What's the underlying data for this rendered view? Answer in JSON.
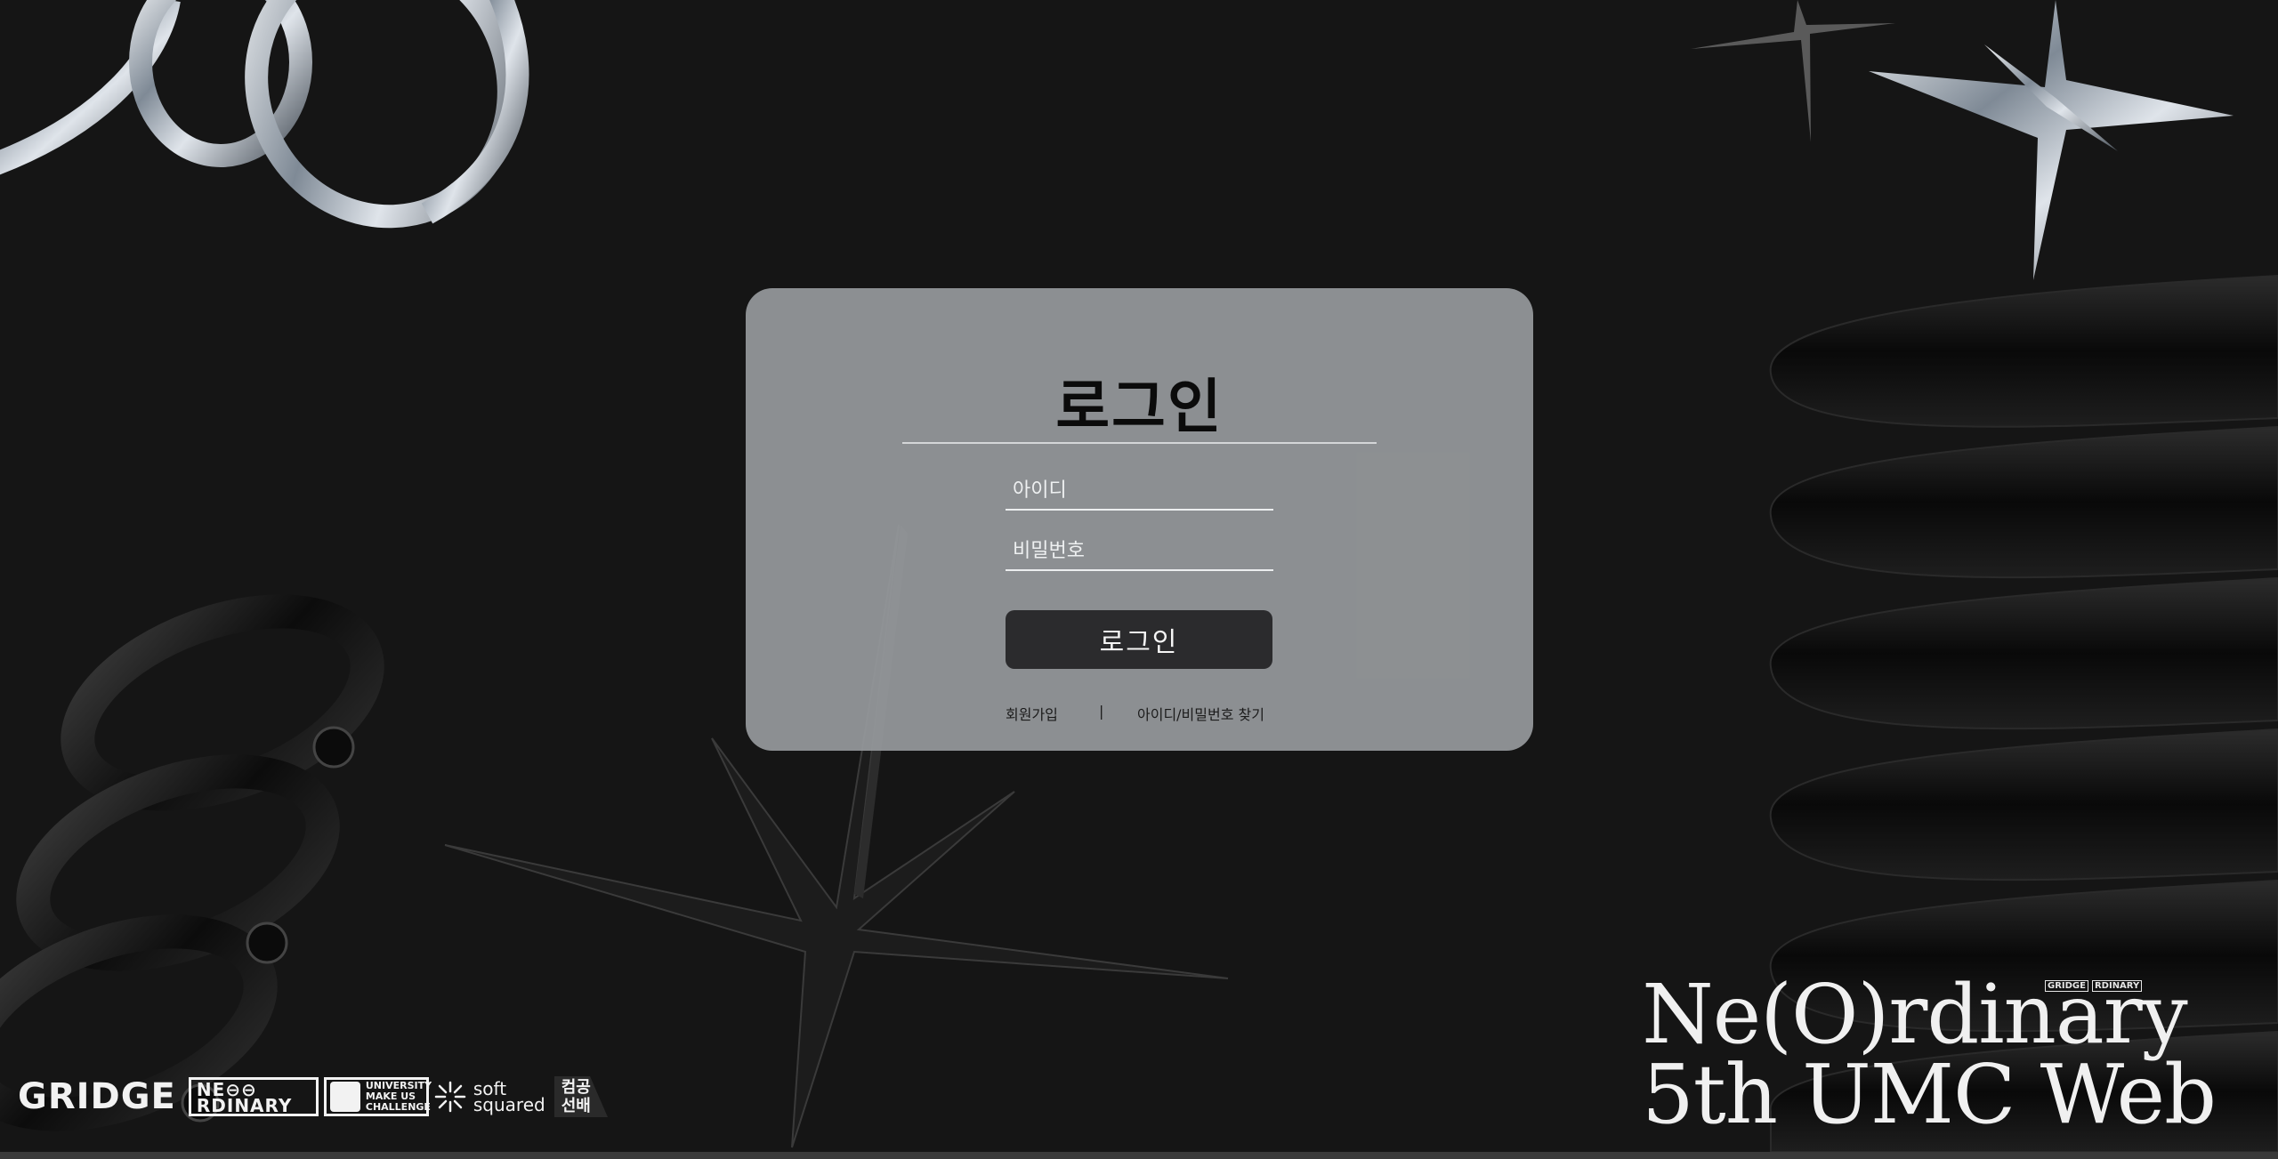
{
  "login": {
    "title": "로그인",
    "id_placeholder": "아이디",
    "password_placeholder": "비밀번호",
    "submit_label": "로그인",
    "signup_link": "회원가입",
    "separator": "|",
    "find_link": "아이디/비밀번호 찾기"
  },
  "brand": {
    "line1": "Ne(O)rdinary",
    "line2": "5th UMC Web"
  },
  "partners": {
    "gridge": "GRIDGE",
    "neordinary_line1": "NE⊖⊖",
    "neordinary_line2": "RDINARY",
    "umc_line1": "UNIVERSITY",
    "umc_line2": "MAKE US",
    "umc_line3": "CHALLENGE",
    "soft_line1": "soft",
    "soft_line2": "squared",
    "senior_line1": "컴공",
    "senior_line2": "선배"
  },
  "colors": {
    "background": "#151515",
    "card": "#96999c",
    "button": "#2b2b2d",
    "text_light": "#f0f0f0"
  }
}
